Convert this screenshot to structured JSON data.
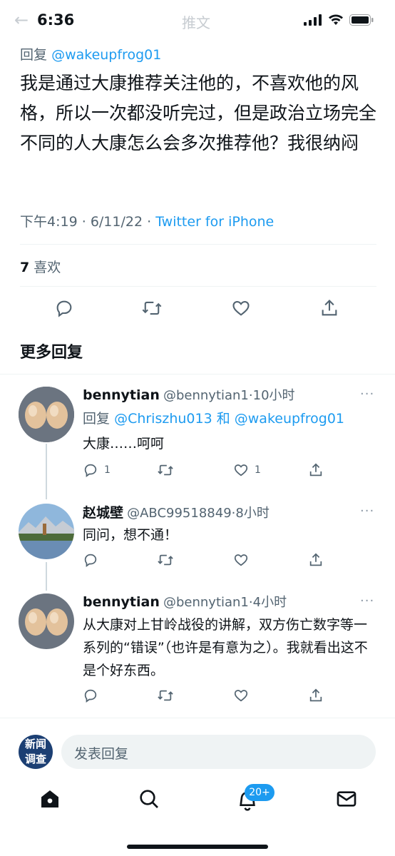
{
  "status_bar": {
    "time": "6:36"
  },
  "header": {
    "title": "推文",
    "back": "←"
  },
  "tweet": {
    "reply_prefix": "回复",
    "reply_handle": "@wakeupfrog01",
    "body": "我是通过大康推荐关注他的，不喜欢他的风格，所以一次都没听完过，但是政治立场完全不同的人大康怎么会多次推荐他？我很纳闷",
    "time": "下午4:19",
    "date": "6/11/22",
    "separator": "·",
    "source": "Twitter for iPhone",
    "likes_count": "7",
    "likes_label": "喜欢"
  },
  "more_replies": {
    "title": "更多回复"
  },
  "replies": [
    {
      "name": "bennytian",
      "handle": "@bennytian1",
      "age": "10小时",
      "reply_prefix": "回复",
      "reply_targets": "@Chriszhu013 和 @wakeupfrog01",
      "text": "大康……呵呵",
      "reply_count": "1",
      "retweet_count": "",
      "like_count": "1",
      "more": "···"
    },
    {
      "name": "赵城壁",
      "handle": "@ABC99518849",
      "age": "8小时",
      "text": "同问，想不通！",
      "more": "···"
    },
    {
      "name": "bennytian",
      "handle": "@bennytian1",
      "age": "4小时",
      "text": "从大康对上甘岭战役的讲解，双方伤亡数字等一系列的“错误”（也许是有意为之）。我就看出这不是个好东西。",
      "more": "···"
    }
  ],
  "compose": {
    "placeholder": "发表回复",
    "avatar_text_1": "新闻",
    "avatar_text_2": "调查"
  },
  "tabbar": {
    "notifications_badge": "20+"
  },
  "colors": {
    "accent": "#1d9bf0",
    "text": "#0f1419",
    "muted": "#536471"
  }
}
